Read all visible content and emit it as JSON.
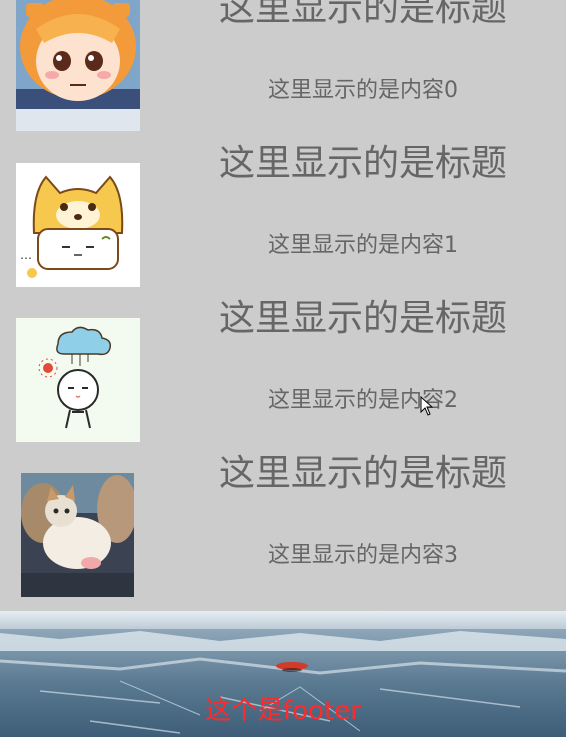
{
  "list": {
    "items": [
      {
        "title": "这里显示的是标题",
        "content": "这里显示的是内容0",
        "thumbnail_icon": "anime-girl-thumbnail"
      },
      {
        "title": "这里显示的是标题",
        "content": "这里显示的是内容1",
        "thumbnail_icon": "shiba-hat-thumbnail"
      },
      {
        "title": "这里显示的是标题",
        "content": "这里显示的是内容2",
        "thumbnail_icon": "cloud-doodle-thumbnail"
      },
      {
        "title": "这里显示的是标题",
        "content": "这里显示的是内容3",
        "thumbnail_icon": "kitten-thumbnail"
      }
    ]
  },
  "footer": {
    "label": "这个是footer",
    "background_image": "frozen-lake-photo"
  },
  "colors": {
    "background": "#cccccc",
    "text": "#666666",
    "footer_text": "#ff2a2a"
  }
}
